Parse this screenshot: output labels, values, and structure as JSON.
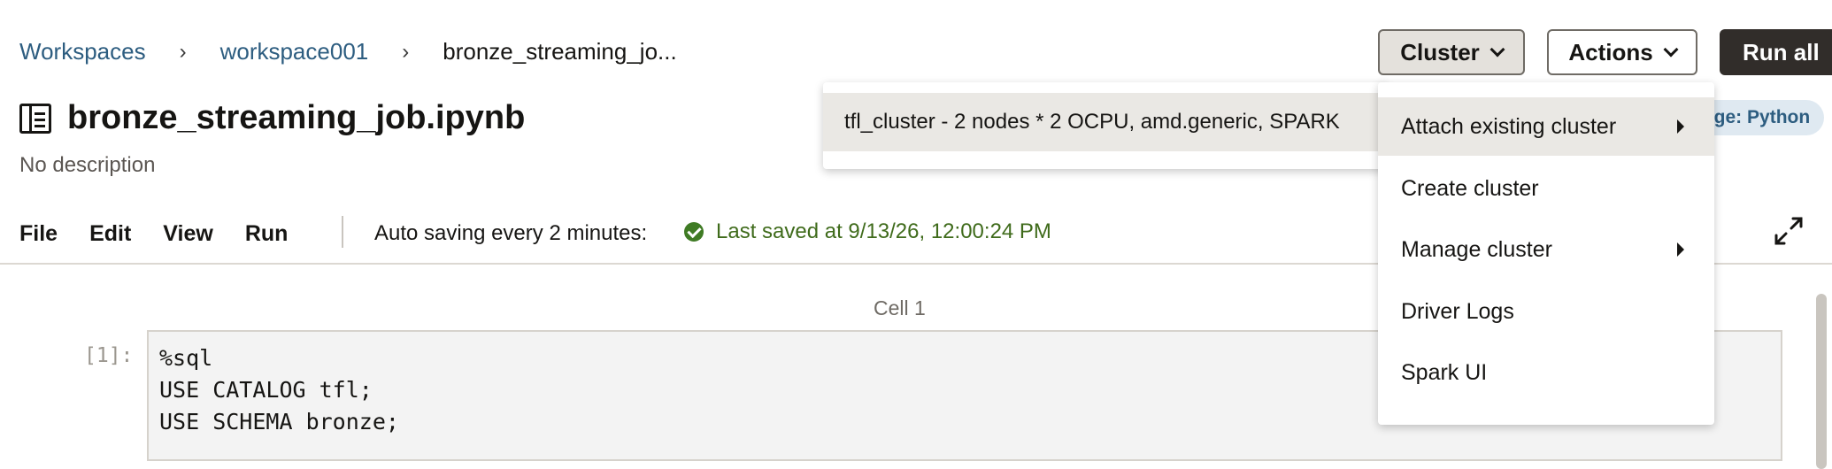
{
  "breadcrumb": {
    "items": [
      "Workspaces",
      "workspace001"
    ],
    "current": "bronze_streaming_jo..."
  },
  "header": {
    "cluster_label": "Cluster",
    "actions_label": "Actions",
    "run_all_label": "Run all"
  },
  "notebook": {
    "title": "bronze_streaming_job.ipynb",
    "description": "No description",
    "language_badge": "age: Python"
  },
  "toolbar": {
    "menus": [
      "File",
      "Edit",
      "View",
      "Run"
    ],
    "autosave_text": "Auto saving every 2 minutes:",
    "last_saved": "Last saved at 9/13/26, 12:00:24 PM"
  },
  "cell": {
    "label": "Cell 1",
    "prompt": "[1]:",
    "code": [
      "%sql",
      "USE CATALOG tfl;",
      "USE SCHEMA bronze;"
    ]
  },
  "cluster_menu": {
    "items": [
      {
        "label": "Attach existing cluster",
        "has_submenu": true,
        "active": true
      },
      {
        "label": "Create cluster",
        "has_submenu": false,
        "active": false
      },
      {
        "label": "Manage cluster",
        "has_submenu": true,
        "active": false
      },
      {
        "label": "Driver Logs",
        "has_submenu": false,
        "active": false
      },
      {
        "label": "Spark UI",
        "has_submenu": false,
        "active": false
      }
    ],
    "submenu_items": [
      "tfl_cluster - 2 nodes * 2 OCPU, amd.generic, SPARK"
    ]
  },
  "colors": {
    "link": "#2d5d80",
    "saved_green": "#3f6b1b",
    "run_all_bg": "#312d2a",
    "badge_bg": "#dfe9f1"
  }
}
